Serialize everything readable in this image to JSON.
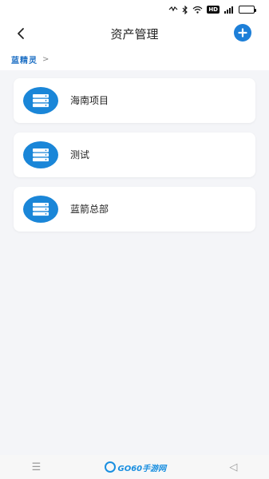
{
  "header": {
    "title": "资产管理"
  },
  "breadcrumb": {
    "root": "蓝精灵",
    "separator": ">"
  },
  "items": [
    {
      "label": "海南项目"
    },
    {
      "label": "测试"
    },
    {
      "label": "蓝箭总部"
    }
  ],
  "status_bar": {
    "hd": "HD",
    "signal": "4G"
  },
  "nav": {
    "menu_glyph": "☰",
    "back_glyph": "◁"
  },
  "watermark": {
    "text": "GO60手游网"
  },
  "colors": {
    "accent": "#1d7fd8",
    "background": "#f4f5f8",
    "breadcrumb": "#1d6fc4"
  },
  "icons": {
    "back": "chevron-left-icon",
    "add": "plus-circle-icon",
    "item": "server-stack-icon"
  }
}
